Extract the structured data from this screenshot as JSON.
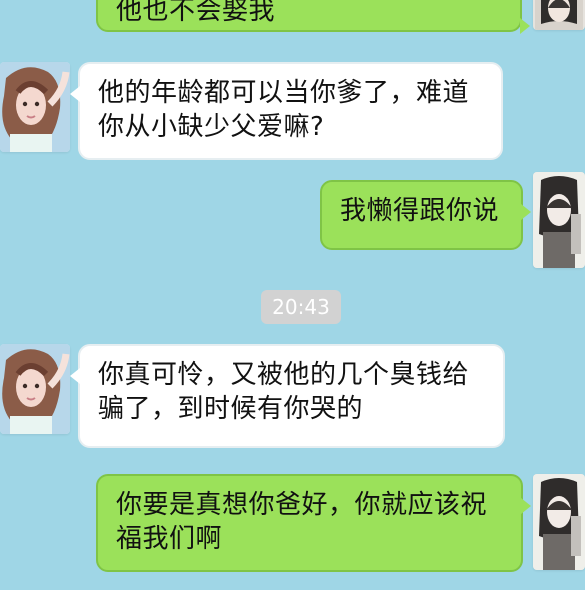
{
  "chat": {
    "time_label": "20:43",
    "messages": [
      {
        "side": "right",
        "color": "green",
        "text": "他也不会娶我"
      },
      {
        "side": "left",
        "color": "white",
        "text": "他的年龄都可以当你爹了，难道\n你从小缺少父爱嘛?"
      },
      {
        "side": "right",
        "color": "green",
        "text": "我懒得跟你说"
      },
      {
        "side": "left",
        "color": "white",
        "text": "你真可怜，又被他的几个臭钱给\n骗了，到时候有你哭的"
      },
      {
        "side": "right",
        "color": "green",
        "text": "你要是真想你爸好，你就应该祝\n福我们啊"
      }
    ]
  },
  "colors": {
    "background": "#9fd6e6",
    "green_bubble": "#9be15a",
    "white_bubble": "#ffffff",
    "timestamp_bg": "#d2d2d2"
  },
  "icons": {
    "left_avatar": "user-avatar-female",
    "right_avatar": "user-avatar-female-2"
  }
}
